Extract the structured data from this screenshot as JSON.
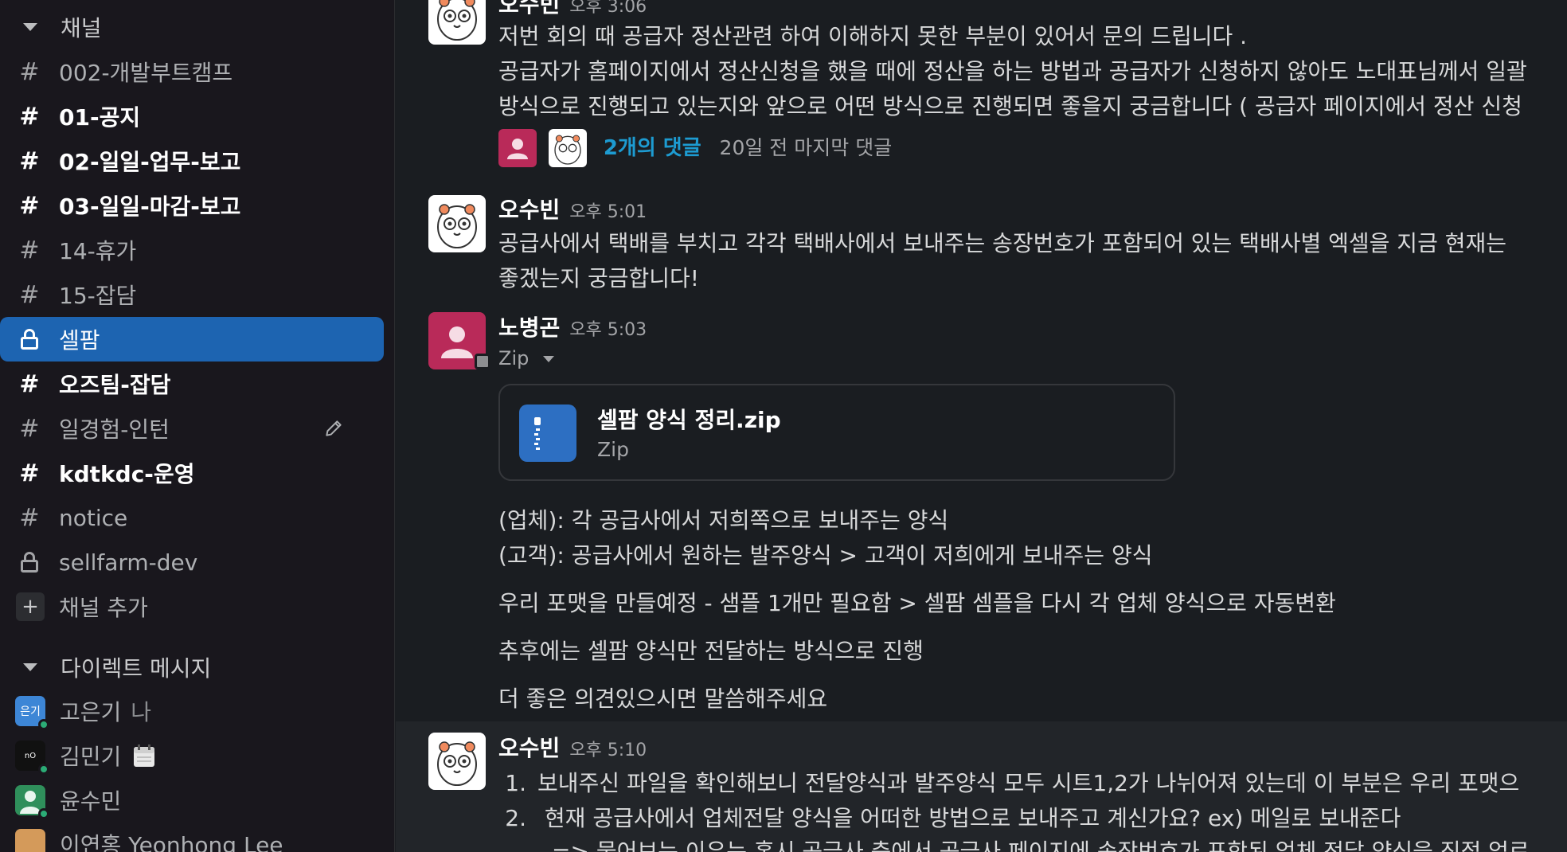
{
  "sidebar": {
    "channels_header": "채널",
    "channels": [
      {
        "label": "002-개발부트캠프",
        "icon": "hash",
        "bold": false
      },
      {
        "label": "01-공지",
        "icon": "hash",
        "bold": true
      },
      {
        "label": "02-일일-업무-보고",
        "icon": "hash",
        "bold": true
      },
      {
        "label": "03-일일-마감-보고",
        "icon": "hash",
        "bold": true
      },
      {
        "label": "14-휴가",
        "icon": "hash",
        "bold": false
      },
      {
        "label": "15-잡담",
        "icon": "hash",
        "bold": false
      },
      {
        "label": "셀팜",
        "icon": "lock",
        "bold": false,
        "active": true
      },
      {
        "label": "오즈팀-잡담",
        "icon": "hash",
        "bold": true
      },
      {
        "label": "일경험-인턴",
        "icon": "hash",
        "bold": false
      },
      {
        "label": "kdtkdc-운영",
        "icon": "hash",
        "bold": true
      },
      {
        "label": "notice",
        "icon": "hash",
        "bold": false
      },
      {
        "label": "sellfarm-dev",
        "icon": "lock",
        "bold": false
      }
    ],
    "add_channel": "채널 추가",
    "dm_header": "다이렉트 메시지",
    "dms": [
      {
        "label": "고은기",
        "suffix": "나",
        "avatar_text": "은기"
      },
      {
        "label": "김민기",
        "suffix": "",
        "avatar_text": "nO"
      },
      {
        "label": "윤수민",
        "suffix": "",
        "avatar_text": ""
      },
      {
        "label": "이연홍 Yeonhong Lee",
        "suffix": "",
        "avatar_text": ""
      }
    ]
  },
  "messages": {
    "m1": {
      "author": "오수빈",
      "time": "오후 3:06",
      "lines": [
        "저번 회의 때 공급자 정산관련 하여 이해하지 못한 부분이 있어서 문의 드립니다 .",
        "공급자가 홈페이지에서 정산신청을 했을 때에 정산을 하는 방법과 공급자가 신청하지 않아도 노대표님께서 일괄",
        "방식으로 진행되고 있는지와 앞으로 어떤 방식으로 진행되면 좋을지 궁금합니다 ( 공급자 페이지에서 정산 신청"
      ],
      "thread_replies": "2개의 댓글",
      "thread_meta": "20일 전 마지막 댓글"
    },
    "m2": {
      "author": "오수빈",
      "time": "오후 5:01",
      "lines": [
        "공급사에서 택배를 부치고 각각 택배사에서 보내주는 송장번호가 포함되어 있는 택배사별 엑셀을 지금 현재는",
        "좋겠는지 궁금합니다!"
      ]
    },
    "m3": {
      "author": "노병곤",
      "time": "오후 5:03",
      "attachment_label": "Zip",
      "file_name": "셀팜 양식 정리.zip",
      "file_type": "Zip",
      "lines": [
        "(업체): 각 공급사에서 저희쪽으로 보내주는 양식",
        "(고객): 공급사에서 원하는 발주양식 > 고객이 저희에게 보내주는 양식",
        "우리 포맷을 만들예정 - 샘플 1개만 필요함 > 셀팜 셈플을 다시 각 업체 양식으로 자동변환",
        "추후에는 셀팜 양식만 전달하는 방식으로 진행",
        "더 좋은 의견있으시면 말씀해주세요"
      ]
    },
    "m4": {
      "author": "오수빈",
      "time": "오후 5:10",
      "items": [
        {
          "num": "1.",
          "text": "보내주신 파일을 확인해보니 전달양식과 발주양식 모두 시트1,2가 나뉘어져 있는데 이 부분은 우리 포맷으"
        },
        {
          "num": "2.",
          "text": " 현재 공급사에서 업체전달 양식을 어떠한 방법으로 보내주고 계신가요? ex) 메일로 보내준다"
        }
      ],
      "trailing": "=> 물어보는 이유는 혹시 공급사 측에서 공급사 페이지에 송장번호가 포함된 업체 전달 양식을 직접 업로"
    }
  },
  "colors": {
    "sidebar_bg": "#19171d",
    "active_bg": "#1d64b1",
    "main_bg": "#1a1d21",
    "link": "#1d9bd1",
    "person_avatar": "#b92a59",
    "zip_icon": "#2d6fc2"
  }
}
